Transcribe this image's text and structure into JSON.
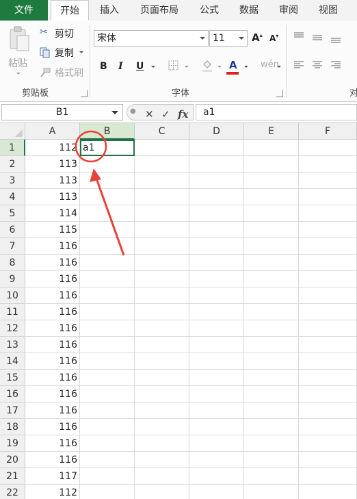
{
  "tabs": [
    "文件",
    "开始",
    "插入",
    "页面布局",
    "公式",
    "数据",
    "审阅",
    "视图"
  ],
  "ribbon": {
    "clipboard": {
      "paste": "粘贴",
      "cut": "剪切",
      "copy": "复制",
      "format_painter": "格式刷",
      "group_label": "剪贴板"
    },
    "font": {
      "font_name": "宋体",
      "font_size": "11",
      "bold": "B",
      "italic": "I",
      "underline": "U",
      "font_color_letter": "A",
      "group_label": "字体"
    },
    "alignment": {
      "group_label_partial": "对"
    }
  },
  "formula_bar": {
    "name_box": "B1",
    "cancel": "✕",
    "enter": "✓",
    "fx": "fx",
    "content": "a1"
  },
  "sheet": {
    "columns": [
      "A",
      "B",
      "C",
      "D",
      "E",
      "F"
    ],
    "selected_column": "B",
    "selected_row": "1",
    "rows": [
      {
        "row": "1",
        "a": "112",
        "b": "a1"
      },
      {
        "row": "2",
        "a": "113",
        "b": ""
      },
      {
        "row": "3",
        "a": "113",
        "b": ""
      },
      {
        "row": "4",
        "a": "113",
        "b": ""
      },
      {
        "row": "5",
        "a": "114",
        "b": ""
      },
      {
        "row": "6",
        "a": "115",
        "b": ""
      },
      {
        "row": "7",
        "a": "116",
        "b": ""
      },
      {
        "row": "8",
        "a": "116",
        "b": ""
      },
      {
        "row": "9",
        "a": "116",
        "b": ""
      },
      {
        "row": "10",
        "a": "116",
        "b": ""
      },
      {
        "row": "11",
        "a": "116",
        "b": ""
      },
      {
        "row": "12",
        "a": "116",
        "b": ""
      },
      {
        "row": "13",
        "a": "116",
        "b": ""
      },
      {
        "row": "14",
        "a": "116",
        "b": ""
      },
      {
        "row": "15",
        "a": "116",
        "b": ""
      },
      {
        "row": "16",
        "a": "116",
        "b": ""
      },
      {
        "row": "17",
        "a": "116",
        "b": ""
      },
      {
        "row": "18",
        "a": "116",
        "b": ""
      },
      {
        "row": "19",
        "a": "116",
        "b": ""
      },
      {
        "row": "20",
        "a": "116",
        "b": ""
      },
      {
        "row": "21",
        "a": "117",
        "b": ""
      },
      {
        "row": "22",
        "a": "112",
        "b": ""
      }
    ]
  },
  "colors": {
    "file_tab": "#1f7a3f",
    "selection": "#217346",
    "annotation": "#e8413a"
  }
}
